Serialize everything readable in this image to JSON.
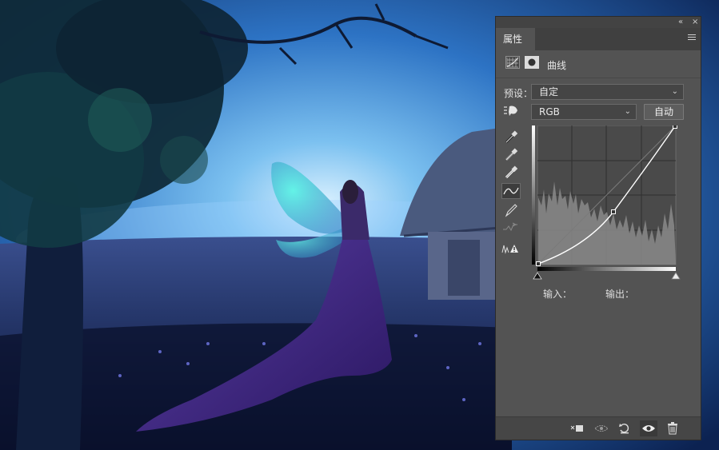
{
  "panel": {
    "collapse_glyph": "«",
    "close_glyph": "×",
    "tab_label": "属性",
    "title": "曲线",
    "preset_label": "预设：",
    "preset_value": "自定",
    "channel_value": "RGB",
    "auto_button": "自动",
    "input_label": "输入：",
    "output_label": "输出："
  },
  "colors": {
    "panel_bg": "#535353",
    "graph_bg": "#4a4a4a",
    "histogram": "#8a8a8a",
    "curve": "#ffffff"
  },
  "icons": [
    "curves-adjustment-icon",
    "mask-icon",
    "target-adjust-icon",
    "black-eyedropper-icon",
    "gray-eyedropper-icon",
    "white-eyedropper-icon",
    "curve-point-tool-icon",
    "pencil-icon",
    "smooth-icon",
    "clipping-warning-icon",
    "clip-to-layer-icon",
    "view-previous-icon",
    "reset-icon",
    "visibility-eye-icon",
    "trash-icon"
  ]
}
